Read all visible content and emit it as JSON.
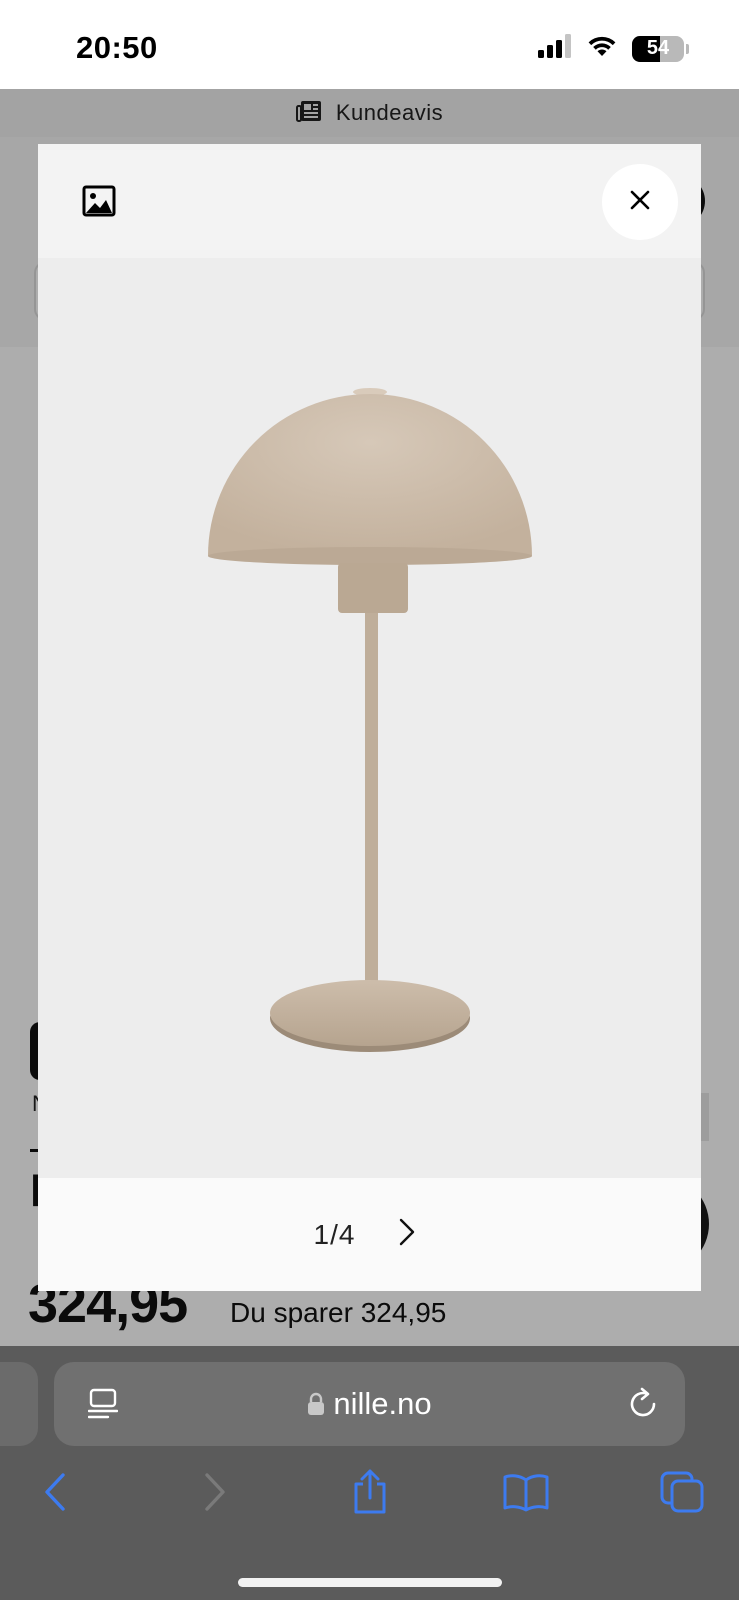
{
  "status_bar": {
    "time": "20:50",
    "battery": "54",
    "icons": [
      "cellular-signal-icon",
      "wifi-icon",
      "battery-icon"
    ]
  },
  "background_page": {
    "newsletter_label": "Kundeavis",
    "product_partial_letter": "l",
    "product_meta_partial": "N",
    "price": "324,95",
    "saving": "Du sparer 324,95"
  },
  "modal": {
    "pager": "1/4",
    "icons": [
      "image-icon",
      "close-icon",
      "chevron-right-icon"
    ]
  },
  "browser": {
    "url": "nille.no",
    "icons": [
      "reader-icon",
      "lock-icon",
      "reload-icon",
      "back-icon",
      "forward-icon",
      "share-icon",
      "bookmarks-icon",
      "tabs-icon"
    ]
  },
  "colors": {
    "accent": "#3d7bf0",
    "lamp": "#cbbba9",
    "toolbar": "#5b5b5b"
  }
}
